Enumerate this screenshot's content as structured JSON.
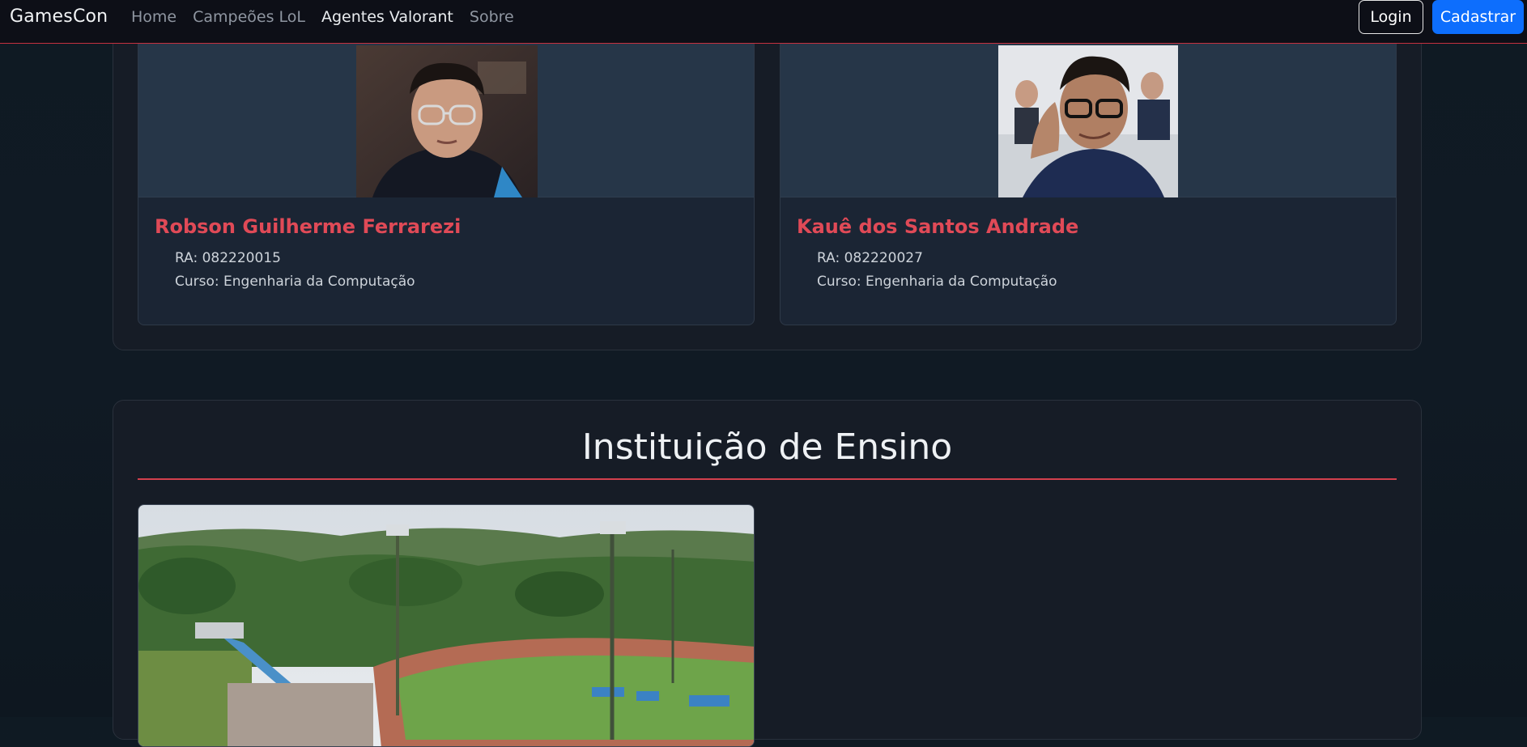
{
  "nav": {
    "brand": "GamesCon",
    "links": [
      "Home",
      "Campeões LoL",
      "Agentes Valorant",
      "Sobre"
    ],
    "active_index": 2,
    "login": "Login",
    "signup": "Cadastrar"
  },
  "members": [
    {
      "name": "Robson Guilherme Ferrarezi",
      "ra": "RA: 082220015",
      "course": "Curso: Engenharia da Computação"
    },
    {
      "name": "Kauê dos Santos Andrade",
      "ra": "RA: 082220027",
      "course": "Curso: Engenharia da Computação"
    }
  ],
  "institution": {
    "title": "Instituição de Ensino"
  },
  "colors": {
    "accent_red": "#e04a57",
    "primary_blue": "#0d6efd",
    "navbar_bg": "#0d0f17",
    "card_bg": "#1b2534"
  }
}
